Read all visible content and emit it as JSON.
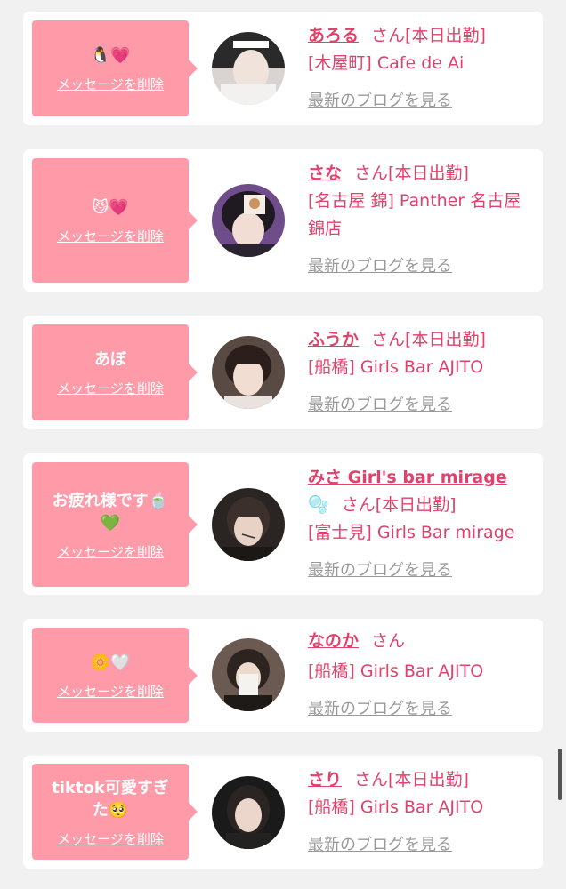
{
  "items": [
    {
      "message": "🐧💗",
      "delete_label": "メッセージを削除",
      "name": "あろる",
      "honorific": "さん",
      "status": "[本日出勤]",
      "shop": "[木屋町] Cafe de Ai",
      "blog_label": "最新のブログを見る"
    },
    {
      "message": "😼💗",
      "delete_label": "メッセージを削除",
      "name": "さな",
      "honorific": "さん",
      "status": "[本日出勤]",
      "shop": "[名古屋 錦] Panther 名古屋錦店",
      "blog_label": "最新のブログを見る"
    },
    {
      "message": "あぼ",
      "delete_label": "メッセージを削除",
      "name": "ふうか",
      "honorific": "さん",
      "status": "[本日出勤]",
      "shop": "[船橋] Girls Bar AJITO",
      "blog_label": "最新のブログを見る"
    },
    {
      "message": "お疲れ様です🍵💚",
      "delete_label": "メッセージを削除",
      "name": "みさ Girl's bar mirage",
      "name_suffix": "🫧",
      "honorific": "さん",
      "status": "[本日出勤]",
      "shop": "[富士見] Girls Bar mirage",
      "blog_label": "最新のブログを見る"
    },
    {
      "message": "🌼🤍",
      "delete_label": "メッセージを削除",
      "name": "なのか",
      "honorific": "さん",
      "status": "",
      "shop": "[船橋] Girls Bar AJITO",
      "blog_label": "最新のブログを見る"
    },
    {
      "message": "tiktok可愛すぎた🥺",
      "delete_label": "メッセージを削除",
      "name": "さり",
      "honorific": "さん",
      "status": "[本日出勤]",
      "shop": "[船橋] Girls Bar AJITO",
      "blog_label": "最新のブログを見る"
    }
  ],
  "colors": {
    "accent": "#e0426b",
    "bubble": "#ff9aa9",
    "muted_link": "#9a9a9a",
    "background": "#f1f1f1",
    "card": "#ffffff"
  }
}
